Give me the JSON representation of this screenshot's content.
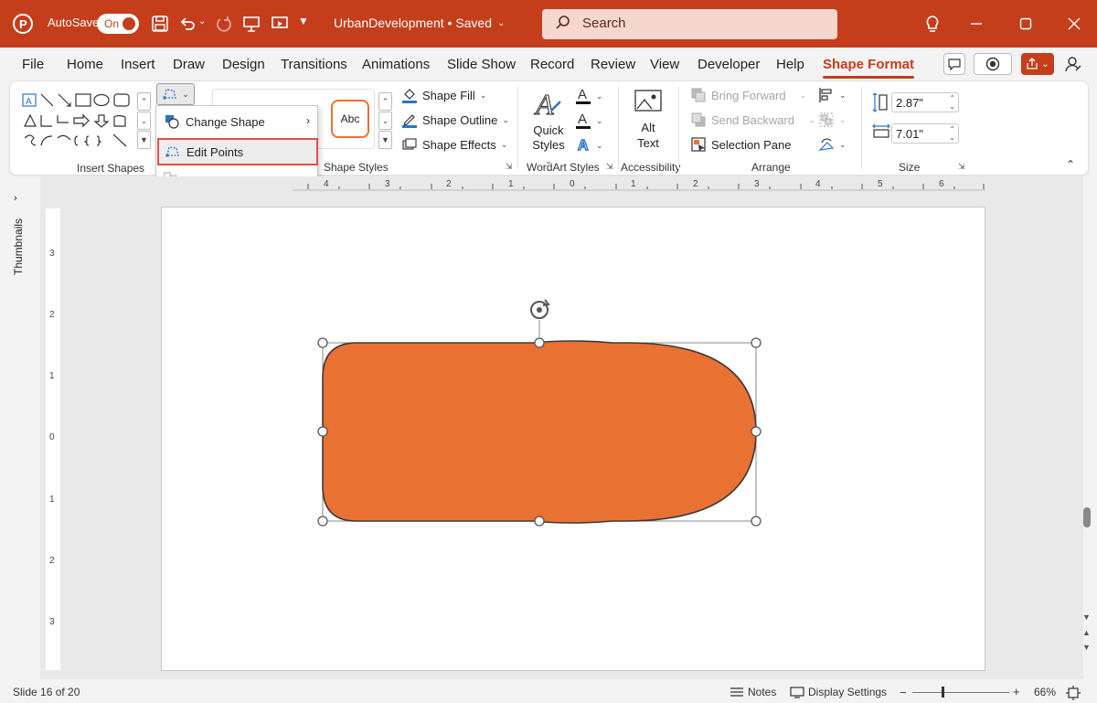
{
  "titlebar": {
    "autosave_label": "AutoSave",
    "toggle_state": "On",
    "document_title": "UrbanDevelopment • Saved",
    "search_placeholder": "Search",
    "accent": "#c43e1c"
  },
  "menu": {
    "tabs": [
      "File",
      "Home",
      "Insert",
      "Draw",
      "Design",
      "Transitions",
      "Animations",
      "Slide Show",
      "Record",
      "Review",
      "View",
      "Developer",
      "Help",
      "Shape Format"
    ],
    "active": "Shape Format"
  },
  "ribbon": {
    "insert_shapes_label": "Insert Shapes",
    "shape_styles_label": "Shape Styles",
    "style_preview_text": "Abc",
    "shape_fill": "Shape Fill",
    "shape_outline": "Shape Outline",
    "shape_effects": "Shape Effects",
    "quick_styles_line1": "Quick",
    "quick_styles_line2": "Styles",
    "wordart_styles_label": "WordArt Styles",
    "alt_text_line1": "Alt",
    "alt_text_line2": "Text",
    "accessibility_label": "Accessibility",
    "bring_forward": "Bring Forward",
    "send_backward": "Send Backward",
    "selection_pane": "Selection Pane",
    "arrange_label": "Arrange",
    "height_value": "2.87\"",
    "width_value": "7.01\"",
    "size_label": "Size"
  },
  "dropdown": {
    "items": [
      "Change Shape",
      "Edit Points",
      "Reroute Connectors"
    ],
    "highlighted": "Edit Points",
    "disabled": "Reroute Connectors"
  },
  "thumbnails_label": "Thumbnails",
  "hruler_labels": [
    "4",
    "3",
    "2",
    "1",
    "0",
    "1",
    "2",
    "3",
    "4",
    "5",
    "6"
  ],
  "vruler_labels": [
    "3",
    "2",
    "1",
    "0",
    "1",
    "2",
    "3"
  ],
  "shape": {
    "fill": "#e97132",
    "outline": "#3a3a3a"
  },
  "status": {
    "slide_info": "Slide 16 of 20",
    "notes": "Notes",
    "display_settings": "Display Settings",
    "zoom": "66%"
  }
}
